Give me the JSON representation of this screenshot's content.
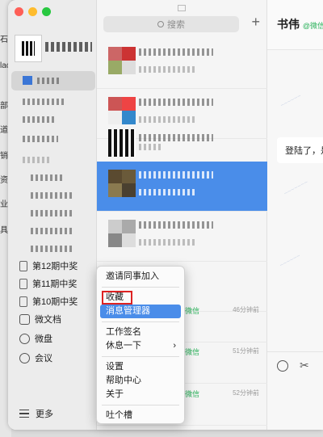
{
  "colors": {
    "accent": "#4a8de9",
    "sidebar_bg": "#ececec",
    "list_bg": "#f5f5f5",
    "wechat_green": "#2ab15a",
    "highlight_box": "#d22222"
  },
  "window": {
    "traffic_lights": [
      "#fe5f57",
      "#febc2e",
      "#28c840"
    ]
  },
  "behind_window_chars": [
    "石",
    "lac",
    "部",
    "道",
    "销",
    "资",
    "业",
    "具"
  ],
  "sidebar": {
    "items": [
      {
        "label": "第12期中奖",
        "icon": "tag-icon"
      },
      {
        "label": "第11期中奖",
        "icon": "tag-icon"
      },
      {
        "label": "第10期中奖",
        "icon": "tag-icon"
      },
      {
        "label": "微文档",
        "icon": "doc-icon"
      },
      {
        "label": "微盘",
        "icon": "drive-icon"
      },
      {
        "label": "会议",
        "icon": "meeting-icon"
      }
    ],
    "more_label": "更多"
  },
  "conversation_list": {
    "search_placeholder": "搜索",
    "add_icon": "plus-icon",
    "rows": [
      {
        "suffix": "",
        "time": ""
      },
      {
        "suffix": "",
        "time": ""
      },
      {
        "suffix": "",
        "time": ""
      },
      {
        "suffix": "",
        "time": ""
      },
      {
        "suffix": "",
        "time": ""
      },
      {
        "suffix": "",
        "time": ""
      },
      {
        "suffix": "@微信",
        "time": "46分钟前"
      },
      {
        "suffix": "@微信",
        "time": "51分钟前"
      },
      {
        "suffix": "@微信",
        "time": "52分钟前"
      }
    ]
  },
  "chat": {
    "name": "书伟",
    "name_suffix": "@微信",
    "bubble_text": "登陆了，是"
  },
  "context_menu": {
    "items": [
      {
        "label": "邀请同事加入"
      },
      {
        "label": "收藏",
        "boxed": true
      },
      {
        "label": "消息管理器",
        "highlighted": true
      },
      {
        "label": "工作签名"
      },
      {
        "label": "休息一下",
        "submenu": true
      },
      {
        "label": "设置"
      },
      {
        "label": "帮助中心"
      },
      {
        "label": "关于"
      },
      {
        "label": "吐个槽"
      }
    ]
  }
}
